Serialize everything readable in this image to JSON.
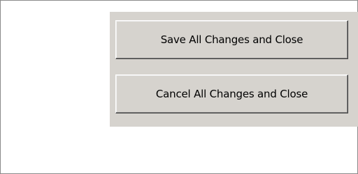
{
  "dialog": {
    "buttons": {
      "save_label": "Save All Changes and Close",
      "cancel_label": "Cancel All Changes and Close"
    }
  },
  "colors": {
    "panel_background": "#d6d3ce",
    "window_background": "#ffffff",
    "frame_border": "#8a8a8a"
  }
}
